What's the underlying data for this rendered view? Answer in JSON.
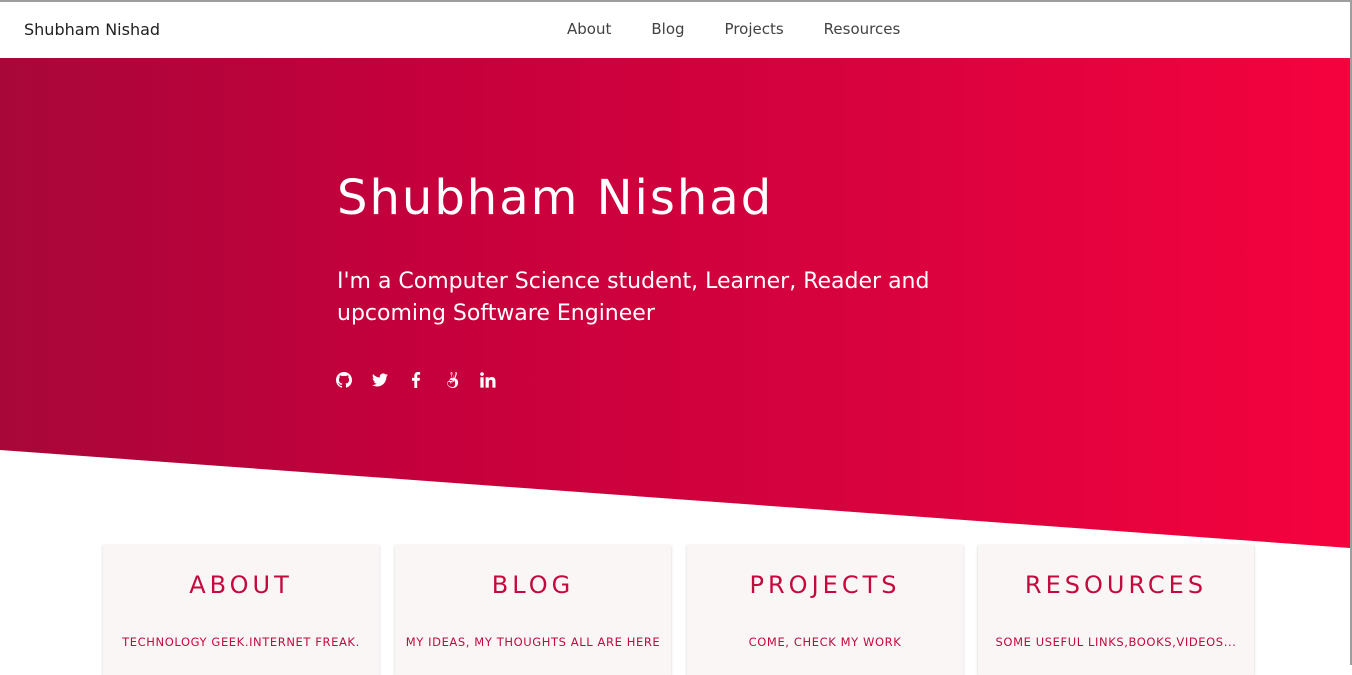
{
  "navbar": {
    "brand": "Shubham Nishad",
    "links": [
      "About",
      "Blog",
      "Projects",
      "Resources"
    ]
  },
  "hero": {
    "title": "Shubham Nishad",
    "subtitle": "I'm a Computer Science student, Learner, Reader and upcoming Software Engineer",
    "social_icons": [
      "github-icon",
      "twitter-icon",
      "facebook-icon",
      "angellist-icon",
      "linkedin-icon"
    ],
    "gradient_colors": [
      "#a8073a",
      "#f5023e"
    ]
  },
  "cards": [
    {
      "title": "ABOUT",
      "description": "TECHNOLOGY GEEK.INTERNET FREAK."
    },
    {
      "title": "BLOG",
      "description": "MY IDEAS, MY THOUGHTS ALL ARE HERE"
    },
    {
      "title": "PROJECTS",
      "description": "COME, CHECK MY WORK"
    },
    {
      "title": "RESOURCES",
      "description": "SOME USEFUL LINKS,BOOKS,VIDEOS..."
    }
  ],
  "colors": {
    "accent": "#c4093f",
    "card_bg": "#faf6f5"
  }
}
